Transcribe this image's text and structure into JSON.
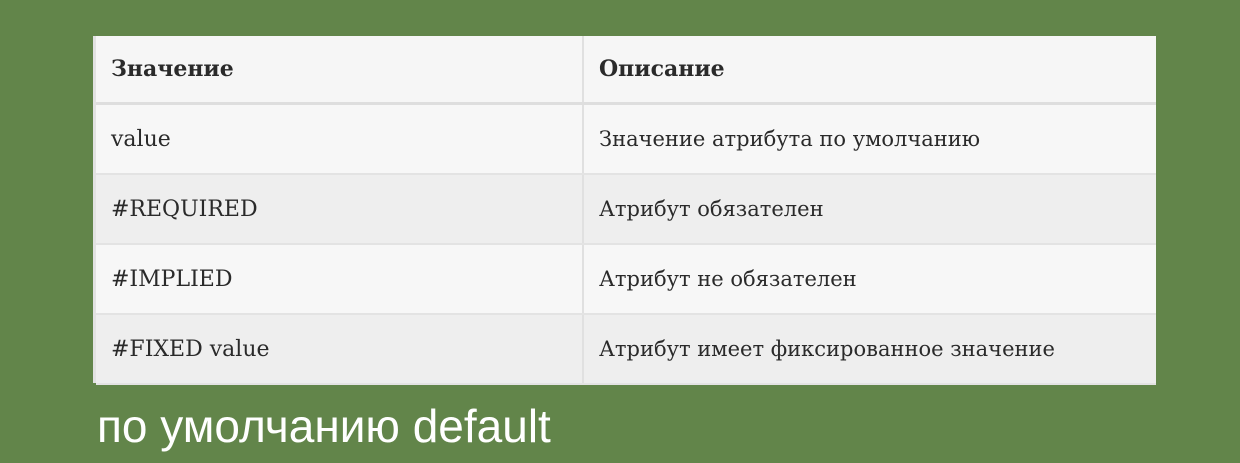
{
  "table": {
    "headers": [
      "Значение",
      "Описание"
    ],
    "rows": [
      {
        "value": "value",
        "description": "Значение атрибута по умолчанию"
      },
      {
        "value": "#REQUIRED",
        "description": "Атрибут обязателен"
      },
      {
        "value": "#IMPLIED",
        "description": "Атрибут не обязателен"
      },
      {
        "value": "#FIXED value",
        "description": "Атрибут имеет фиксированное значение"
      }
    ]
  },
  "caption": "по умолчанию default",
  "colors": {
    "background": "#62854a",
    "table_background": "#f8f8f8",
    "caption_text": "#ffffff"
  }
}
